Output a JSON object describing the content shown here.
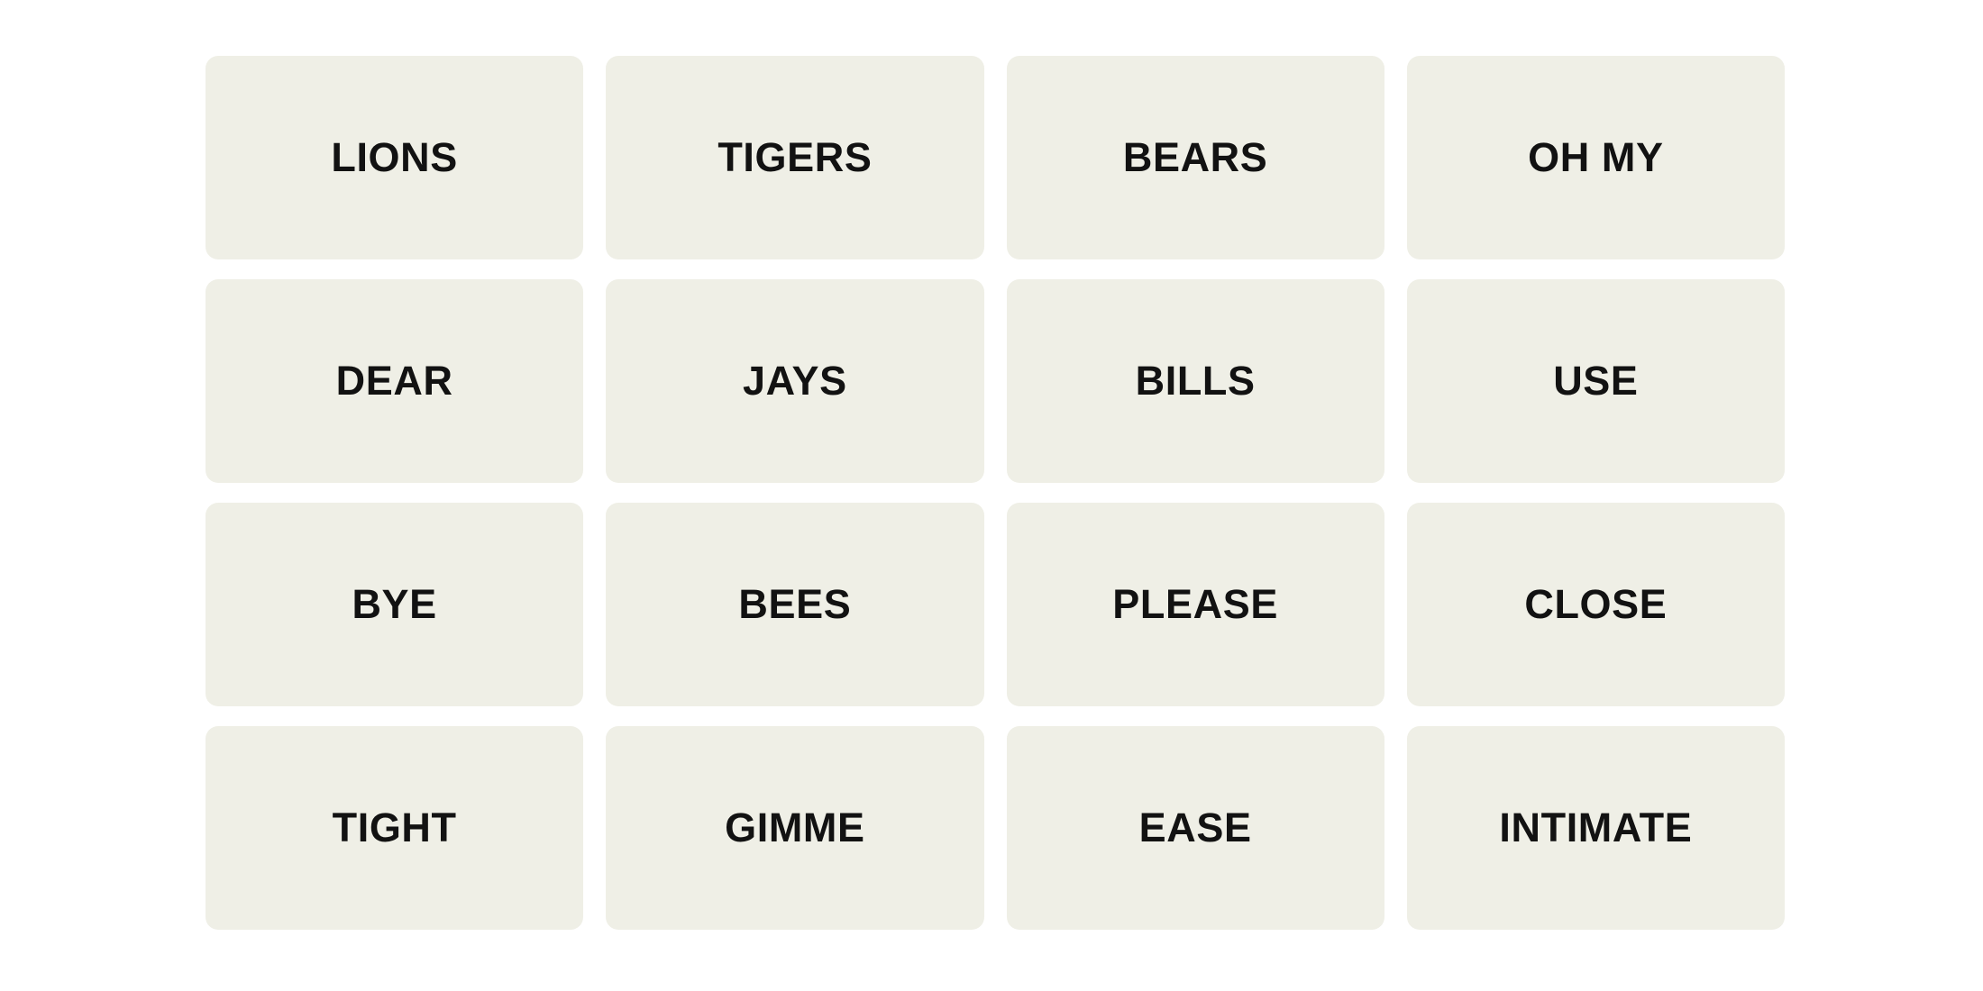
{
  "board": {
    "rows": 4,
    "columns": 4,
    "background_color": "#ffffff",
    "tile_color": "#efefe6",
    "tile_text_color": "#121212",
    "tiles": [
      {
        "label": "LIONS",
        "row": 1,
        "column": 1
      },
      {
        "label": "TIGERS",
        "row": 1,
        "column": 2
      },
      {
        "label": "BEARS",
        "row": 1,
        "column": 3
      },
      {
        "label": "OH MY",
        "row": 1,
        "column": 4
      },
      {
        "label": "DEAR",
        "row": 2,
        "column": 1
      },
      {
        "label": "JAYS",
        "row": 2,
        "column": 2
      },
      {
        "label": "BILLS",
        "row": 2,
        "column": 3
      },
      {
        "label": "USE",
        "row": 2,
        "column": 4
      },
      {
        "label": "BYE",
        "row": 3,
        "column": 1
      },
      {
        "label": "BEES",
        "row": 3,
        "column": 2
      },
      {
        "label": "PLEASE",
        "row": 3,
        "column": 3
      },
      {
        "label": "CLOSE",
        "row": 3,
        "column": 4
      },
      {
        "label": "TIGHT",
        "row": 4,
        "column": 1
      },
      {
        "label": "GIMME",
        "row": 4,
        "column": 2
      },
      {
        "label": "EASE",
        "row": 4,
        "column": 3
      },
      {
        "label": "INTIMATE",
        "row": 4,
        "column": 4
      }
    ]
  }
}
